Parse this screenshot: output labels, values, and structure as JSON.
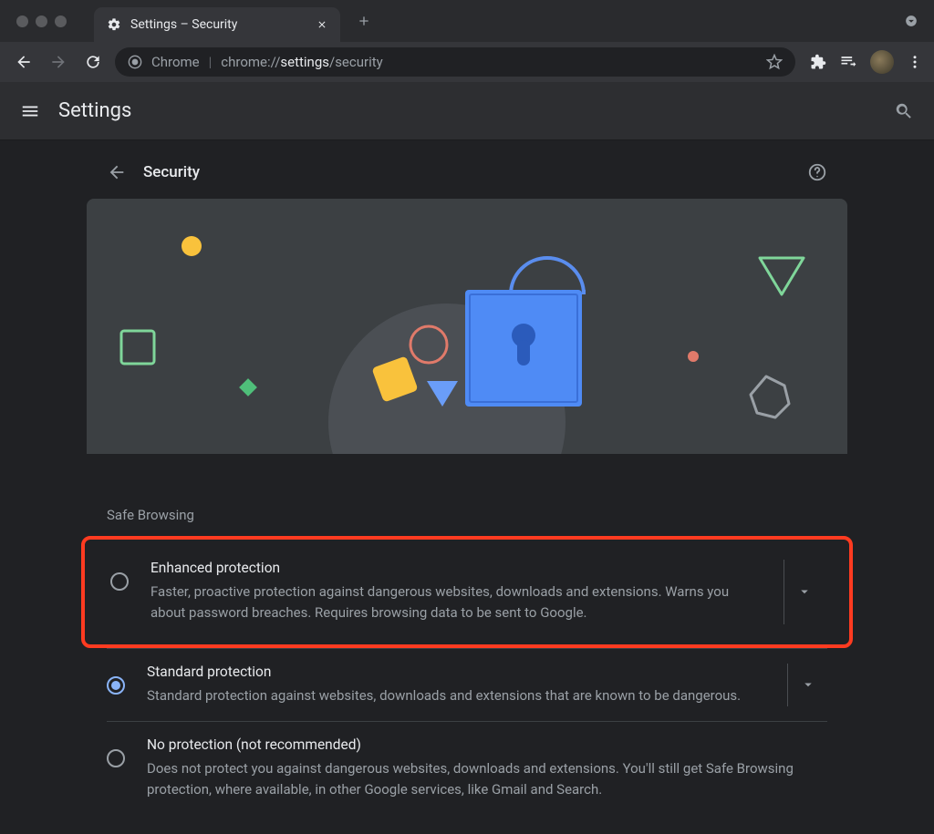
{
  "window": {
    "tab_title": "Settings – Security"
  },
  "omnibox": {
    "scheme_label": "Chrome",
    "url_prefix": "chrome://",
    "url_bold": "settings",
    "url_suffix": "/security"
  },
  "settings_bar": {
    "title": "Settings"
  },
  "section": {
    "title": "Security"
  },
  "safe_browsing": {
    "heading": "Safe Browsing",
    "options": [
      {
        "title": "Enhanced protection",
        "desc": "Faster, proactive protection against dangerous websites, downloads and extensions. Warns you about password breaches. Requires browsing data to be sent to Google.",
        "selected": false,
        "expandable": true,
        "highlighted": true
      },
      {
        "title": "Standard protection",
        "desc": "Standard protection against websites, downloads and extensions that are known to be dangerous.",
        "selected": true,
        "expandable": true,
        "highlighted": false
      },
      {
        "title": "No protection (not recommended)",
        "desc": "Does not protect you against dangerous websites, downloads and extensions. You'll still get Safe Browsing protection, where available, in other Google services, like Gmail and Search.",
        "selected": false,
        "expandable": false,
        "highlighted": false
      }
    ]
  }
}
